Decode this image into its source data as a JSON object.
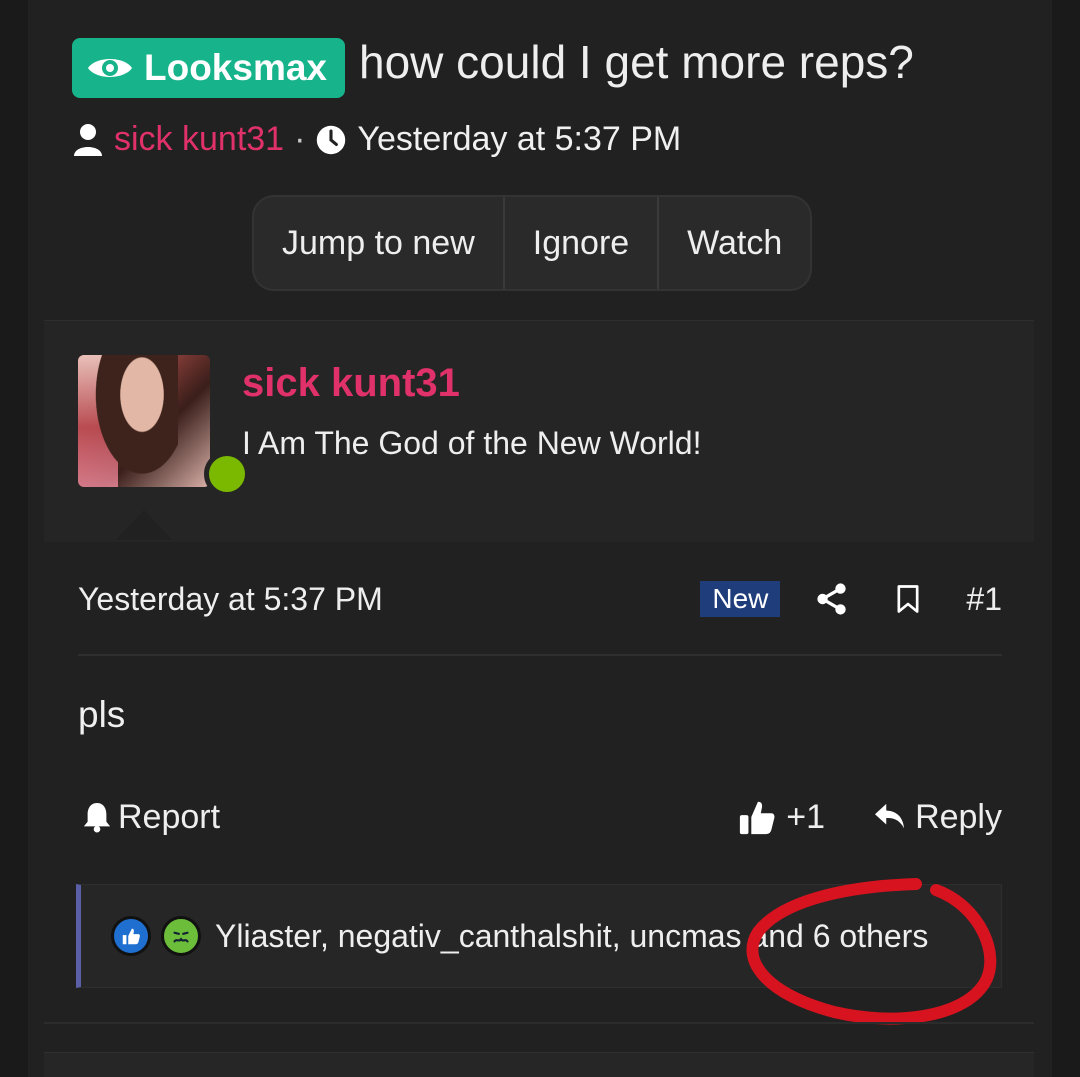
{
  "thread": {
    "prefix": "Looksmax",
    "title": "how could I get more reps?",
    "author": "sick kunt31",
    "date": "Yesterday at 5:37 PM"
  },
  "thread_actions": {
    "jump_label": "Jump to new",
    "ignore_label": "Ignore",
    "watch_label": "Watch"
  },
  "post": {
    "username": "sick kunt31",
    "user_title": "I Am The God of the New World!",
    "date": "Yesterday at 5:37 PM",
    "new_badge": "New",
    "number": "#1",
    "body": "pls",
    "report_label": "Report",
    "like_count": "+1",
    "reply_label": "Reply"
  },
  "reactions": {
    "text": "Yliaster, negativ_canthalshit, uncmas",
    "others": "and 6 others"
  },
  "colors": {
    "prefix_badge": "#17b38a",
    "username": "#e0316a",
    "new_badge": "#1f3d7a",
    "online": "#7bb800",
    "annotation": "#d6131f"
  },
  "icons": [
    "eye-icon",
    "user-icon",
    "clock-icon",
    "share-icon",
    "bookmark-icon",
    "bell-icon",
    "thumbs-up-icon",
    "reply-icon"
  ]
}
